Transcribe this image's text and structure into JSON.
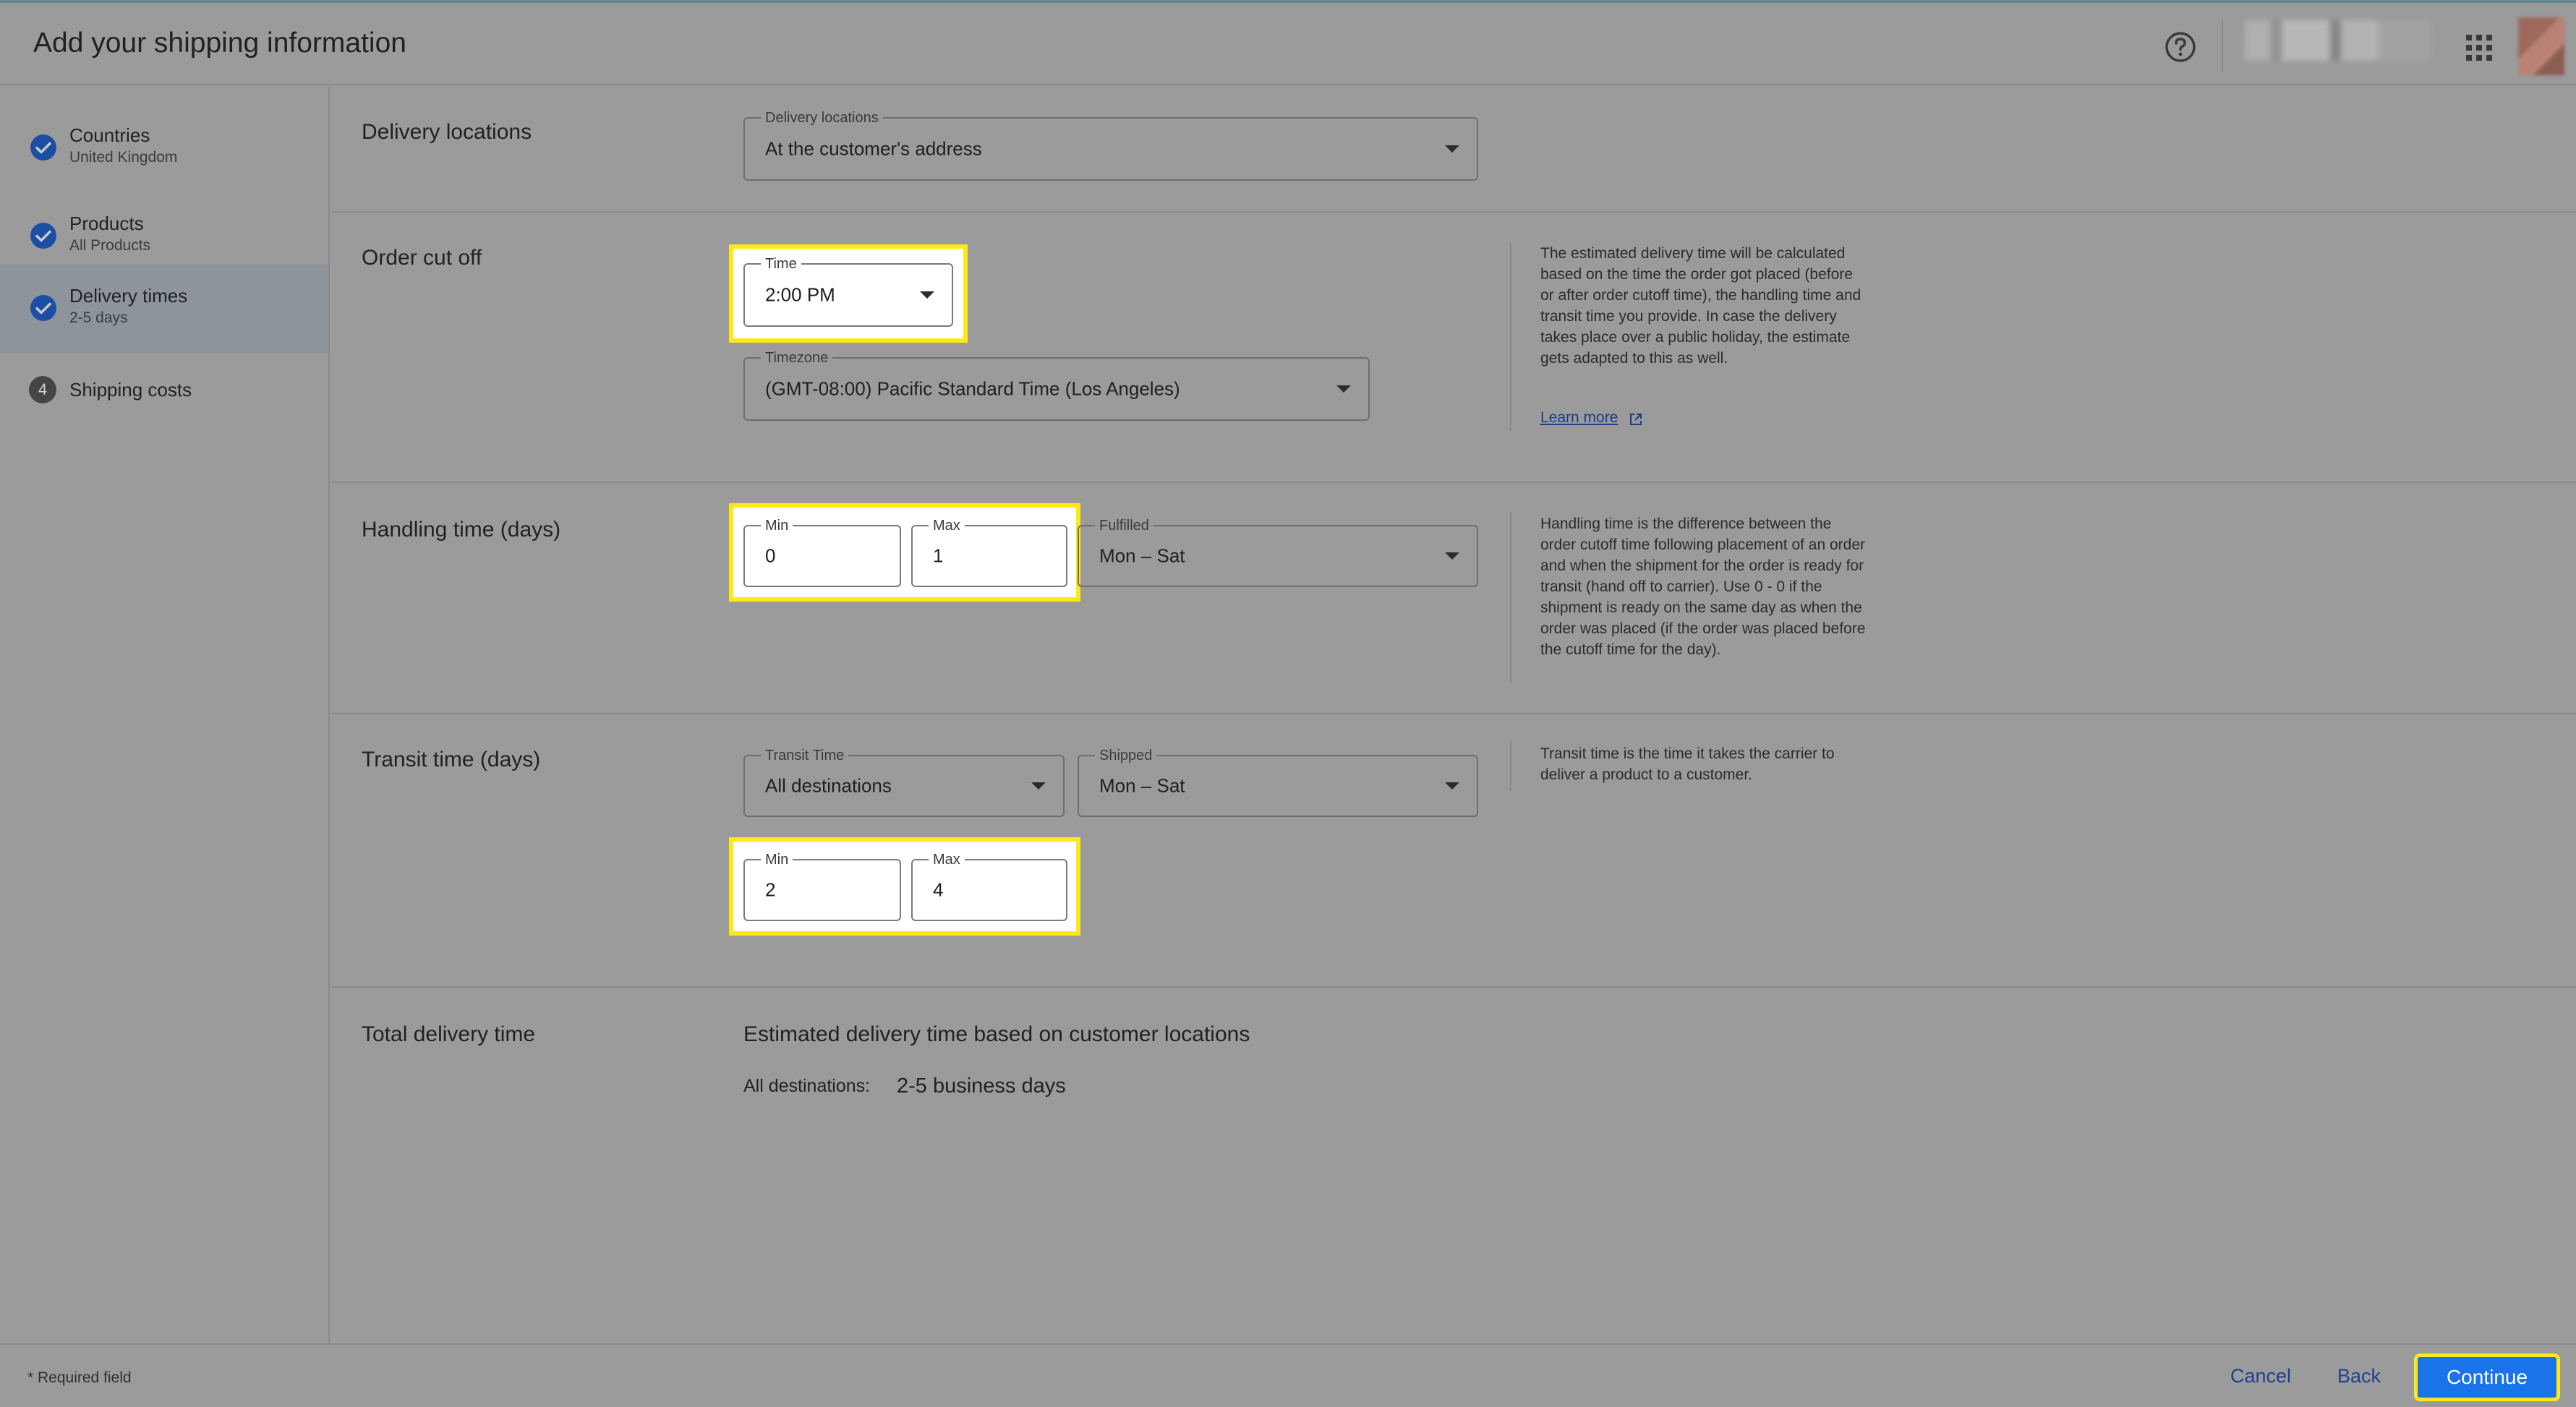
{
  "header": {
    "title": "Add your shipping information",
    "help_icon": "help-circle-icon",
    "apps_icon": "apps-grid-icon"
  },
  "sidebar": {
    "steps": [
      {
        "title": "Countries",
        "subtitle": "United Kingdom",
        "status": "complete"
      },
      {
        "title": "Products",
        "subtitle": "All Products",
        "status": "complete"
      },
      {
        "title": "Delivery times",
        "subtitle": "2-5 days",
        "status": "complete",
        "active": true
      },
      {
        "title": "Shipping costs",
        "number": "4",
        "status": "pending"
      }
    ]
  },
  "delivery_locations": {
    "title": "Delivery locations",
    "field_label": "Delivery locations",
    "value": "At the customer's address"
  },
  "order_cutoff": {
    "title": "Order cut off",
    "time_label": "Time",
    "time_value": "2:00 PM",
    "timezone_label": "Timezone",
    "timezone_value": "(GMT-08:00) Pacific Standard Time (Los Angeles)",
    "help": "The estimated delivery time will be calculated based on the time the order got placed (before or after order cutoff time), the handling time and transit time you provide. In case the delivery takes place over a public holiday, the estimate gets adapted to this as well.",
    "learn_more": "Learn more"
  },
  "handling_time": {
    "title": "Handling time (days)",
    "min_label": "Min",
    "min_value": "0",
    "max_label": "Max",
    "max_value": "1",
    "fulfilled_label": "Fulfilled",
    "fulfilled_value": "Mon – Sat",
    "help": "Handling time is the difference between the order cutoff time following placement of an order and when the shipment for the order is ready for transit (hand off to carrier). Use 0 - 0 if the shipment is ready on the same day as when the order was placed (if the order was placed before the cutoff time for the day)."
  },
  "transit_time": {
    "title": "Transit time (days)",
    "transit_label": "Transit Time",
    "transit_value": "All destinations",
    "shipped_label": "Shipped",
    "shipped_value": "Mon – Sat",
    "min_label": "Min",
    "min_value": "2",
    "max_label": "Max",
    "max_value": "4",
    "help": "Transit time is the time it takes the carrier to deliver a product to a customer."
  },
  "total": {
    "title": "Total delivery time",
    "heading": "Estimated delivery time based on customer locations",
    "dest_label": "All destinations:",
    "dest_value": "2-5 business days"
  },
  "footer": {
    "required_note": "* Required field",
    "cancel": "Cancel",
    "back": "Back",
    "continue": "Continue"
  },
  "colors": {
    "primary": "#1a73e8",
    "highlight": "#ffe81a",
    "overlay_background": "#9b9b9b"
  }
}
